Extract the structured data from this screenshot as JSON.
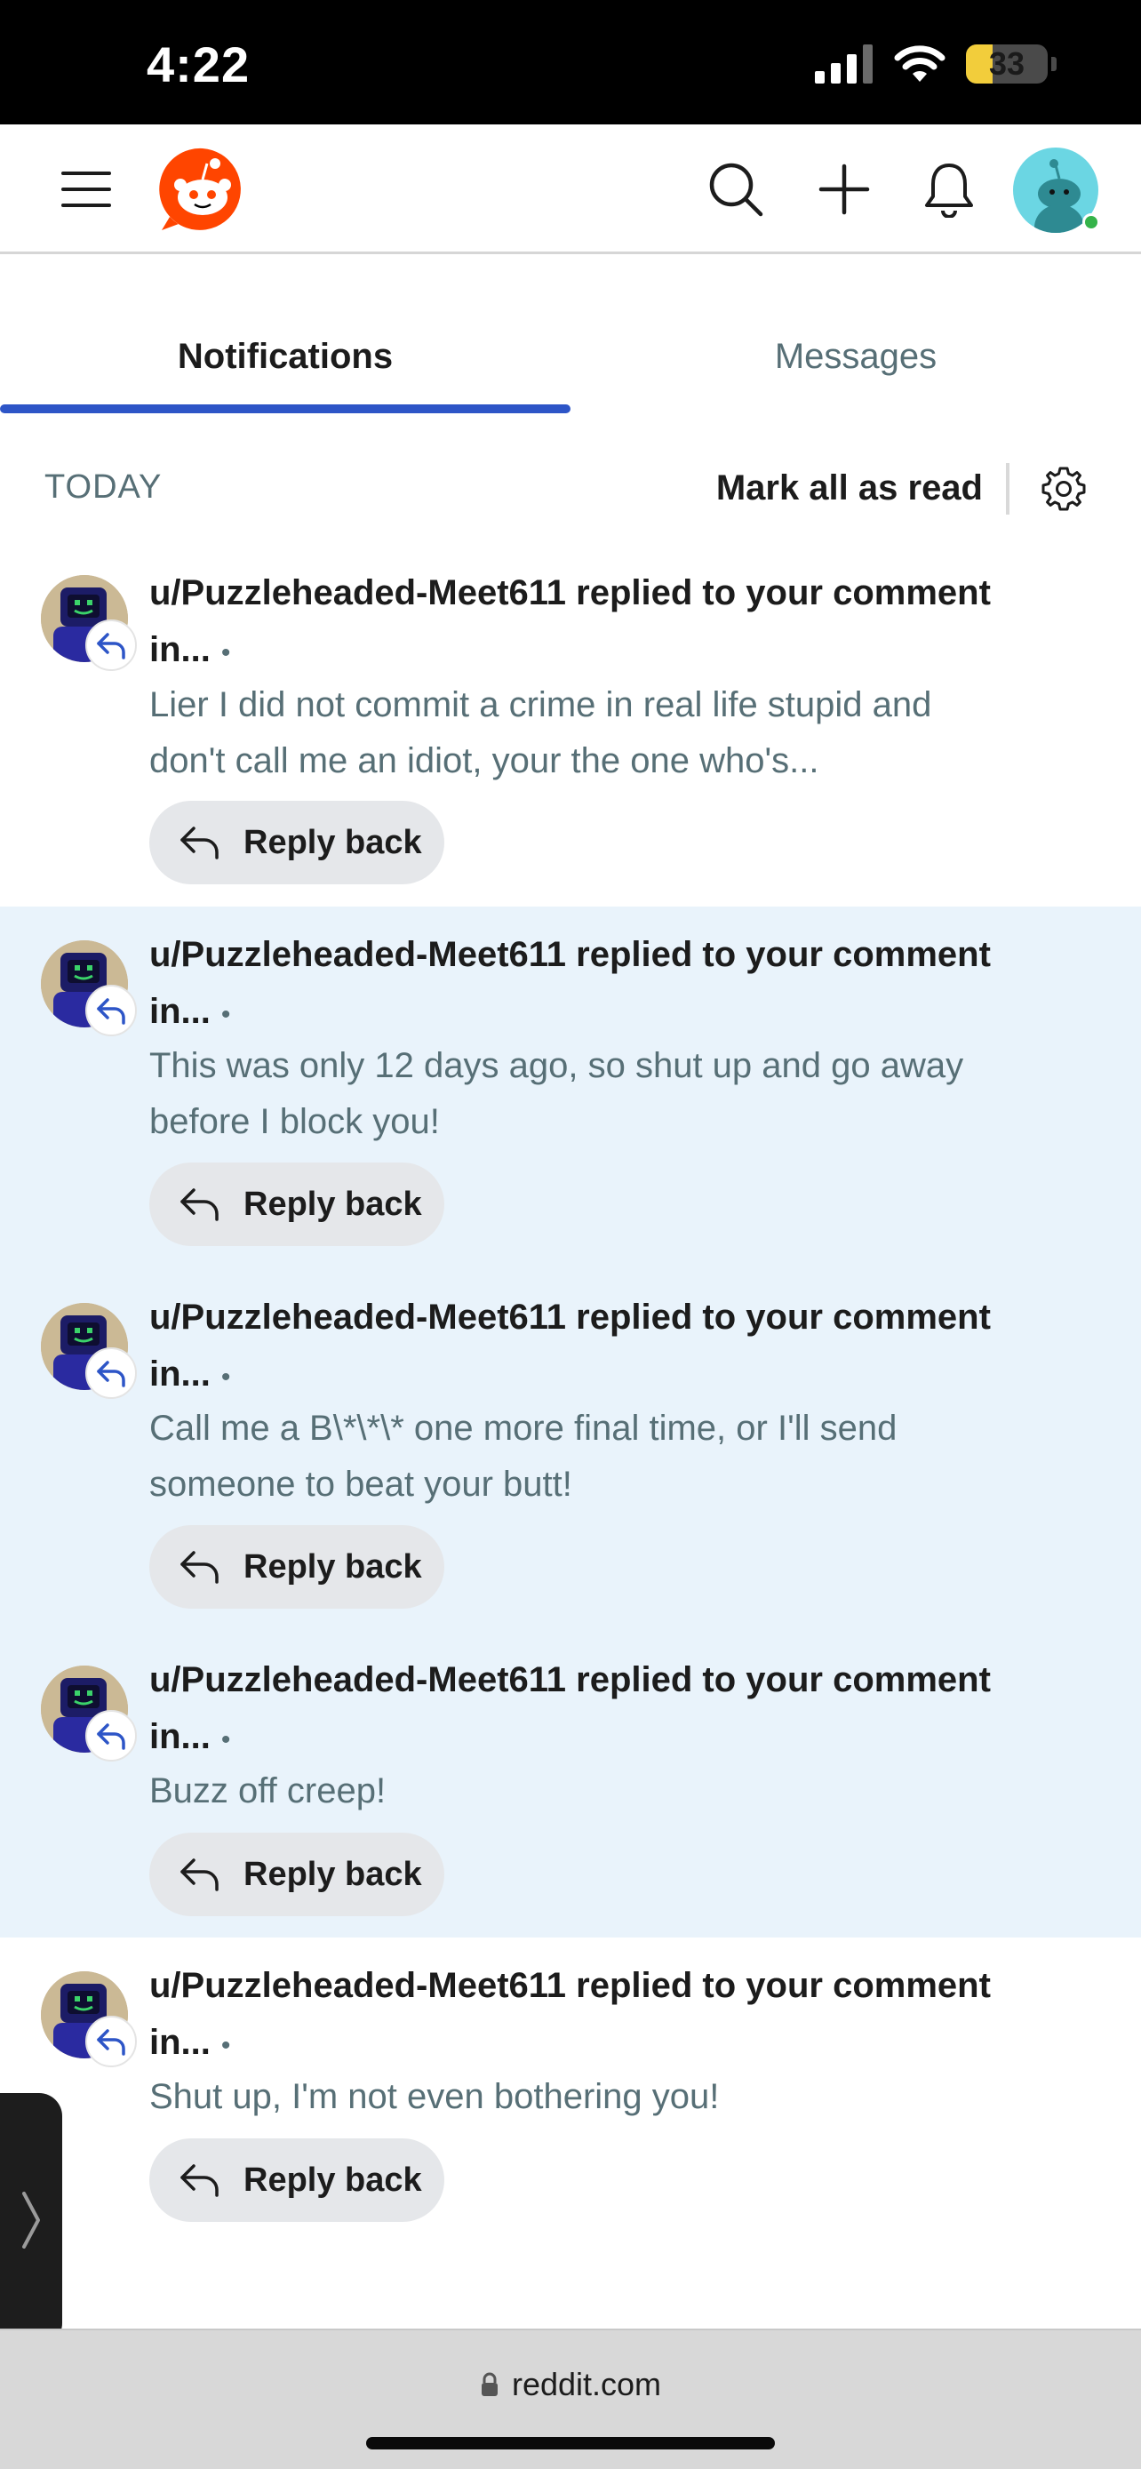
{
  "status_bar": {
    "time": "4:22",
    "battery": "33",
    "battery_percent": 33
  },
  "header": {
    "menu_icon": "hamburger-icon",
    "logo_icon": "reddit-snoo-logo",
    "search_icon": "search-icon",
    "create_icon": "plus-icon",
    "notifications_icon": "bell-icon"
  },
  "tabs": [
    {
      "label": "Notifications",
      "active": true
    },
    {
      "label": "Messages",
      "active": false
    }
  ],
  "section": {
    "label": "TODAY",
    "mark_all_label": "Mark all as read"
  },
  "notifications": [
    {
      "title": "u/Puzzleheaded-Meet611 replied to your comment in...",
      "dot": "•",
      "body": "Lier I did not commit a crime in real life stupid and don't call me an idiot, your the one who's...",
      "reply_label": "Reply back",
      "unread": false
    },
    {
      "title": "u/Puzzleheaded-Meet611 replied to your comment in...",
      "dot": "•",
      "body": "This was only 12 days ago, so shut up and go away before I block you!",
      "reply_label": "Reply back",
      "unread": true
    },
    {
      "title": "u/Puzzleheaded-Meet611 replied to your comment in...",
      "dot": "•",
      "body": "Call me a B\\*\\*\\* one more final time, or I'll send someone to beat your butt!",
      "reply_label": "Reply back",
      "unread": true
    },
    {
      "title": "u/Puzzleheaded-Meet611 replied to your comment in...",
      "dot": "•",
      "body": "Buzz off creep!",
      "reply_label": "Reply back",
      "unread": true
    },
    {
      "title": "u/Puzzleheaded-Meet611 replied to your comment in...",
      "dot": "•",
      "body": "Shut up, I'm not even bothering you!",
      "reply_label": "Reply back",
      "unread": false
    }
  ],
  "url_bar": {
    "url": "reddit.com"
  },
  "colors": {
    "accent_blue": "#2d55c7",
    "reddit_orange": "#ff4500",
    "unread_bg": "#e9f3fb",
    "secondary_text": "#576f76",
    "battery_yellow": "#f2cd3b"
  }
}
